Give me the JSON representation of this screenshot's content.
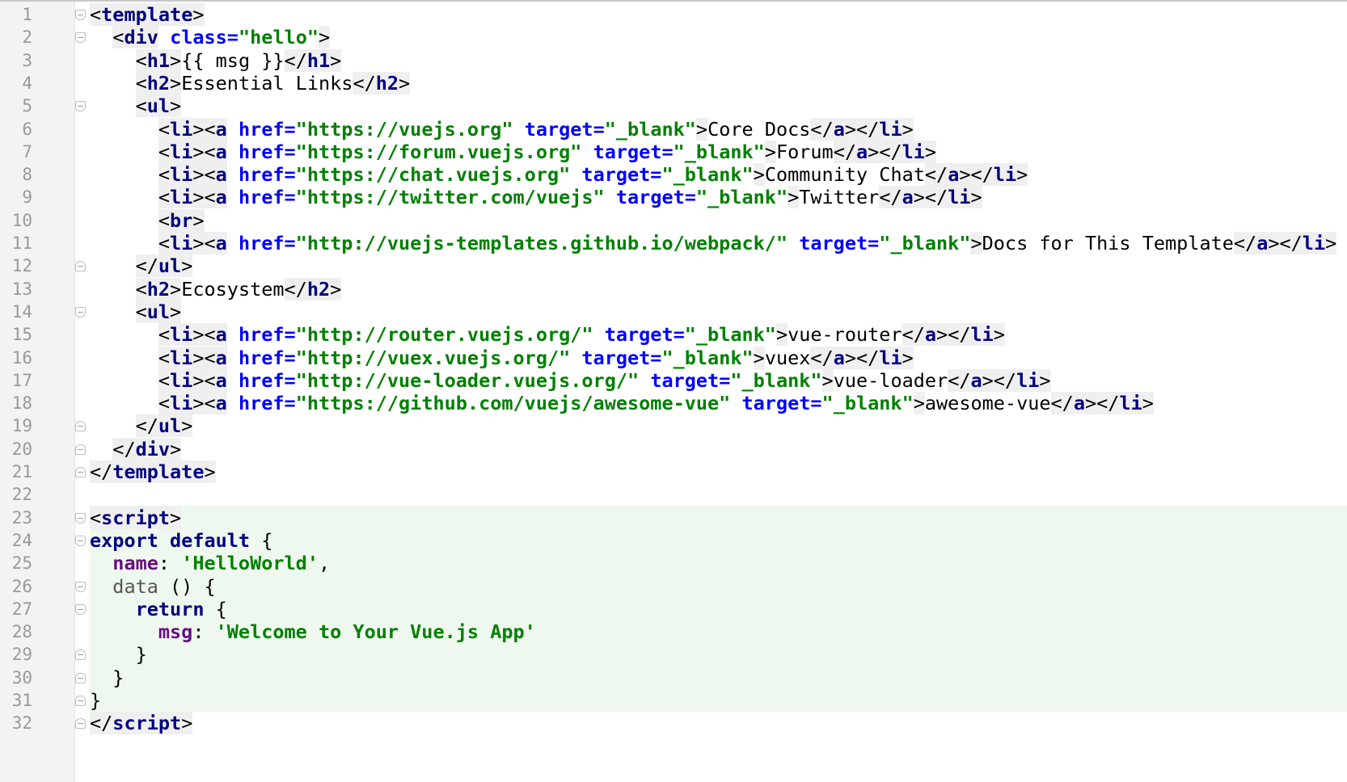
{
  "colors": {
    "tag": "#000080",
    "attribute": "#0000ff",
    "string": "#008000",
    "keyword": "#000080",
    "property": "#660e7a",
    "script_highlight": "#eef8ee",
    "gutter": "#f3f3f3"
  },
  "lines": [
    {
      "n": "1",
      "fold": "open",
      "tokens": [
        [
          "<",
          "bracket"
        ],
        [
          "template",
          "tag"
        ],
        [
          ">",
          "bracket"
        ]
      ]
    },
    {
      "n": "2",
      "fold": "open",
      "tokens": [
        [
          "  ",
          "plain"
        ],
        [
          "<",
          "bracket"
        ],
        [
          "div",
          "tag"
        ],
        [
          " ",
          "plain"
        ],
        [
          "class=",
          "attr"
        ],
        [
          "\"hello\"",
          "str"
        ],
        [
          ">",
          "bracket"
        ]
      ]
    },
    {
      "n": "3",
      "fold": "",
      "tokens": [
        [
          "    ",
          "plain"
        ],
        [
          "<",
          "bracket"
        ],
        [
          "h1",
          "tag"
        ],
        [
          ">",
          "bracket"
        ],
        [
          "{{ msg }}",
          "plain"
        ],
        [
          "</",
          "bracket"
        ],
        [
          "h1",
          "tag"
        ],
        [
          ">",
          "bracket"
        ]
      ]
    },
    {
      "n": "4",
      "fold": "",
      "tokens": [
        [
          "    ",
          "plain"
        ],
        [
          "<",
          "bracket"
        ],
        [
          "h2",
          "tag"
        ],
        [
          ">",
          "bracket"
        ],
        [
          "Essential Links",
          "plain"
        ],
        [
          "</",
          "bracket"
        ],
        [
          "h2",
          "tag"
        ],
        [
          ">",
          "bracket"
        ]
      ]
    },
    {
      "n": "5",
      "fold": "open",
      "tokens": [
        [
          "    ",
          "plain"
        ],
        [
          "<",
          "bracket"
        ],
        [
          "ul",
          "tag"
        ],
        [
          ">",
          "bracket"
        ]
      ]
    },
    {
      "n": "6",
      "fold": "",
      "tokens": [
        [
          "      ",
          "plain"
        ],
        [
          "<",
          "bracket"
        ],
        [
          "li",
          "tag"
        ],
        [
          "><",
          "bracket"
        ],
        [
          "a",
          "tag"
        ],
        [
          " ",
          "plain"
        ],
        [
          "href=",
          "attr"
        ],
        [
          "\"https://vuejs.org\"",
          "str"
        ],
        [
          " ",
          "plain"
        ],
        [
          "target=",
          "attr"
        ],
        [
          "\"_blank\"",
          "str"
        ],
        [
          ">",
          "bracket"
        ],
        [
          "Core Docs",
          "plain"
        ],
        [
          "</",
          "bracket"
        ],
        [
          "a",
          "tag"
        ],
        [
          "></",
          "bracket"
        ],
        [
          "li",
          "tag"
        ],
        [
          ">",
          "bracket"
        ]
      ]
    },
    {
      "n": "7",
      "fold": "",
      "tokens": [
        [
          "      ",
          "plain"
        ],
        [
          "<",
          "bracket"
        ],
        [
          "li",
          "tag"
        ],
        [
          "><",
          "bracket"
        ],
        [
          "a",
          "tag"
        ],
        [
          " ",
          "plain"
        ],
        [
          "href=",
          "attr"
        ],
        [
          "\"https://forum.vuejs.org\"",
          "str"
        ],
        [
          " ",
          "plain"
        ],
        [
          "target=",
          "attr"
        ],
        [
          "\"_blank\"",
          "str"
        ],
        [
          ">",
          "bracket"
        ],
        [
          "Forum",
          "plain"
        ],
        [
          "</",
          "bracket"
        ],
        [
          "a",
          "tag"
        ],
        [
          "></",
          "bracket"
        ],
        [
          "li",
          "tag"
        ],
        [
          ">",
          "bracket"
        ]
      ]
    },
    {
      "n": "8",
      "fold": "",
      "tokens": [
        [
          "      ",
          "plain"
        ],
        [
          "<",
          "bracket"
        ],
        [
          "li",
          "tag"
        ],
        [
          "><",
          "bracket"
        ],
        [
          "a",
          "tag"
        ],
        [
          " ",
          "plain"
        ],
        [
          "href=",
          "attr"
        ],
        [
          "\"https://chat.vuejs.org\"",
          "str"
        ],
        [
          " ",
          "plain"
        ],
        [
          "target=",
          "attr"
        ],
        [
          "\"_blank\"",
          "str"
        ],
        [
          ">",
          "bracket"
        ],
        [
          "Community Chat",
          "plain"
        ],
        [
          "</",
          "bracket"
        ],
        [
          "a",
          "tag"
        ],
        [
          "></",
          "bracket"
        ],
        [
          "li",
          "tag"
        ],
        [
          ">",
          "bracket"
        ]
      ]
    },
    {
      "n": "9",
      "fold": "",
      "tokens": [
        [
          "      ",
          "plain"
        ],
        [
          "<",
          "bracket"
        ],
        [
          "li",
          "tag"
        ],
        [
          "><",
          "bracket"
        ],
        [
          "a",
          "tag"
        ],
        [
          " ",
          "plain"
        ],
        [
          "href=",
          "attr"
        ],
        [
          "\"https://twitter.com/vuejs\"",
          "str"
        ],
        [
          " ",
          "plain"
        ],
        [
          "target=",
          "attr"
        ],
        [
          "\"_blank\"",
          "str"
        ],
        [
          ">",
          "bracket"
        ],
        [
          "Twitter",
          "plain"
        ],
        [
          "</",
          "bracket"
        ],
        [
          "a",
          "tag"
        ],
        [
          "></",
          "bracket"
        ],
        [
          "li",
          "tag"
        ],
        [
          ">",
          "bracket"
        ]
      ]
    },
    {
      "n": "10",
      "fold": "",
      "tokens": [
        [
          "      ",
          "plain"
        ],
        [
          "<",
          "bracket"
        ],
        [
          "br",
          "tag"
        ],
        [
          ">",
          "bracket"
        ]
      ]
    },
    {
      "n": "11",
      "fold": "",
      "tokens": [
        [
          "      ",
          "plain"
        ],
        [
          "<",
          "bracket"
        ],
        [
          "li",
          "tag"
        ],
        [
          "><",
          "bracket"
        ],
        [
          "a",
          "tag"
        ],
        [
          " ",
          "plain"
        ],
        [
          "href=",
          "attr"
        ],
        [
          "\"http://vuejs-templates.github.io/webpack/\"",
          "str"
        ],
        [
          " ",
          "plain"
        ],
        [
          "target=",
          "attr"
        ],
        [
          "\"_blank\"",
          "str"
        ],
        [
          ">",
          "bracket"
        ],
        [
          "Docs for This Template",
          "plain"
        ],
        [
          "</",
          "bracket"
        ],
        [
          "a",
          "tag"
        ],
        [
          "></",
          "bracket"
        ],
        [
          "li",
          "tag"
        ],
        [
          ">",
          "bracket"
        ]
      ]
    },
    {
      "n": "12",
      "fold": "close",
      "tokens": [
        [
          "    ",
          "plain"
        ],
        [
          "</",
          "bracket"
        ],
        [
          "ul",
          "tag"
        ],
        [
          ">",
          "bracket"
        ]
      ]
    },
    {
      "n": "13",
      "fold": "",
      "tokens": [
        [
          "    ",
          "plain"
        ],
        [
          "<",
          "bracket"
        ],
        [
          "h2",
          "tag"
        ],
        [
          ">",
          "bracket"
        ],
        [
          "Ecosystem",
          "plain"
        ],
        [
          "</",
          "bracket"
        ],
        [
          "h2",
          "tag"
        ],
        [
          ">",
          "bracket"
        ]
      ]
    },
    {
      "n": "14",
      "fold": "open",
      "tokens": [
        [
          "    ",
          "plain"
        ],
        [
          "<",
          "bracket"
        ],
        [
          "ul",
          "tag"
        ],
        [
          ">",
          "bracket"
        ]
      ]
    },
    {
      "n": "15",
      "fold": "",
      "tokens": [
        [
          "      ",
          "plain"
        ],
        [
          "<",
          "bracket"
        ],
        [
          "li",
          "tag"
        ],
        [
          "><",
          "bracket"
        ],
        [
          "a",
          "tag"
        ],
        [
          " ",
          "plain"
        ],
        [
          "href=",
          "attr"
        ],
        [
          "\"http://router.vuejs.org/\"",
          "str"
        ],
        [
          " ",
          "plain"
        ],
        [
          "target=",
          "attr"
        ],
        [
          "\"_blank\"",
          "str"
        ],
        [
          ">",
          "bracket"
        ],
        [
          "vue-router",
          "plain"
        ],
        [
          "</",
          "bracket"
        ],
        [
          "a",
          "tag"
        ],
        [
          "></",
          "bracket"
        ],
        [
          "li",
          "tag"
        ],
        [
          ">",
          "bracket"
        ]
      ]
    },
    {
      "n": "16",
      "fold": "",
      "tokens": [
        [
          "      ",
          "plain"
        ],
        [
          "<",
          "bracket"
        ],
        [
          "li",
          "tag"
        ],
        [
          "><",
          "bracket"
        ],
        [
          "a",
          "tag"
        ],
        [
          " ",
          "plain"
        ],
        [
          "href=",
          "attr"
        ],
        [
          "\"http://vuex.vuejs.org/\"",
          "str"
        ],
        [
          " ",
          "plain"
        ],
        [
          "target=",
          "attr"
        ],
        [
          "\"_blank\"",
          "str"
        ],
        [
          ">",
          "bracket"
        ],
        [
          "vuex",
          "plain"
        ],
        [
          "</",
          "bracket"
        ],
        [
          "a",
          "tag"
        ],
        [
          "></",
          "bracket"
        ],
        [
          "li",
          "tag"
        ],
        [
          ">",
          "bracket"
        ]
      ]
    },
    {
      "n": "17",
      "fold": "",
      "tokens": [
        [
          "      ",
          "plain"
        ],
        [
          "<",
          "bracket"
        ],
        [
          "li",
          "tag"
        ],
        [
          "><",
          "bracket"
        ],
        [
          "a",
          "tag"
        ],
        [
          " ",
          "plain"
        ],
        [
          "href=",
          "attr"
        ],
        [
          "\"http://vue-loader.vuejs.org/\"",
          "str"
        ],
        [
          " ",
          "plain"
        ],
        [
          "target=",
          "attr"
        ],
        [
          "\"_blank\"",
          "str"
        ],
        [
          ">",
          "bracket"
        ],
        [
          "vue-loader",
          "plain"
        ],
        [
          "</",
          "bracket"
        ],
        [
          "a",
          "tag"
        ],
        [
          "></",
          "bracket"
        ],
        [
          "li",
          "tag"
        ],
        [
          ">",
          "bracket"
        ]
      ]
    },
    {
      "n": "18",
      "fold": "",
      "tokens": [
        [
          "      ",
          "plain"
        ],
        [
          "<",
          "bracket"
        ],
        [
          "li",
          "tag"
        ],
        [
          "><",
          "bracket"
        ],
        [
          "a",
          "tag"
        ],
        [
          " ",
          "plain"
        ],
        [
          "href=",
          "attr"
        ],
        [
          "\"https://github.com/vuejs/awesome-vue\"",
          "str"
        ],
        [
          " ",
          "plain"
        ],
        [
          "target=",
          "attr"
        ],
        [
          "\"_blank\"",
          "str"
        ],
        [
          ">",
          "bracket"
        ],
        [
          "awesome-vue",
          "plain"
        ],
        [
          "</",
          "bracket"
        ],
        [
          "a",
          "tag"
        ],
        [
          "></",
          "bracket"
        ],
        [
          "li",
          "tag"
        ],
        [
          ">",
          "bracket"
        ]
      ]
    },
    {
      "n": "19",
      "fold": "close",
      "tokens": [
        [
          "    ",
          "plain"
        ],
        [
          "</",
          "bracket"
        ],
        [
          "ul",
          "tag"
        ],
        [
          ">",
          "bracket"
        ]
      ]
    },
    {
      "n": "20",
      "fold": "close",
      "tokens": [
        [
          "  ",
          "plain"
        ],
        [
          "</",
          "bracket"
        ],
        [
          "div",
          "tag"
        ],
        [
          ">",
          "bracket"
        ]
      ]
    },
    {
      "n": "21",
      "fold": "close",
      "tokens": [
        [
          "</",
          "bracket"
        ],
        [
          "template",
          "tag"
        ],
        [
          ">",
          "bracket"
        ]
      ]
    },
    {
      "n": "22",
      "fold": "",
      "tokens": []
    },
    {
      "n": "23",
      "fold": "open",
      "tokens": [
        [
          "<",
          "bracket"
        ],
        [
          "script",
          "tag"
        ],
        [
          ">",
          "bracket"
        ]
      ]
    },
    {
      "n": "24",
      "fold": "open",
      "tokens": [
        [
          "export default",
          "kw"
        ],
        [
          " {",
          "plain"
        ]
      ]
    },
    {
      "n": "25",
      "fold": "",
      "tokens": [
        [
          "  ",
          "plain"
        ],
        [
          "name",
          "prop"
        ],
        [
          ": ",
          "plain"
        ],
        [
          "'HelloWorld'",
          "str"
        ],
        [
          ",",
          "plain"
        ]
      ]
    },
    {
      "n": "26",
      "fold": "open",
      "tokens": [
        [
          "  ",
          "plain"
        ],
        [
          "data",
          "func"
        ],
        [
          " () {",
          "plain"
        ]
      ]
    },
    {
      "n": "27",
      "fold": "open",
      "tokens": [
        [
          "    ",
          "plain"
        ],
        [
          "return",
          "kw"
        ],
        [
          " {",
          "plain"
        ]
      ]
    },
    {
      "n": "28",
      "fold": "",
      "tokens": [
        [
          "      ",
          "plain"
        ],
        [
          "msg",
          "prop"
        ],
        [
          ": ",
          "plain"
        ],
        [
          "'Welcome to Your Vue.js App'",
          "str"
        ]
      ]
    },
    {
      "n": "29",
      "fold": "close",
      "tokens": [
        [
          "    }",
          "plain"
        ]
      ]
    },
    {
      "n": "30",
      "fold": "close",
      "tokens": [
        [
          "  }",
          "plain"
        ]
      ]
    },
    {
      "n": "31",
      "fold": "close",
      "tokens": [
        [
          "}",
          "plain"
        ]
      ]
    },
    {
      "n": "32",
      "fold": "close",
      "tokens": [
        [
          "</",
          "bracket"
        ],
        [
          "script",
          "tag"
        ],
        [
          ">",
          "bracket"
        ]
      ]
    }
  ]
}
